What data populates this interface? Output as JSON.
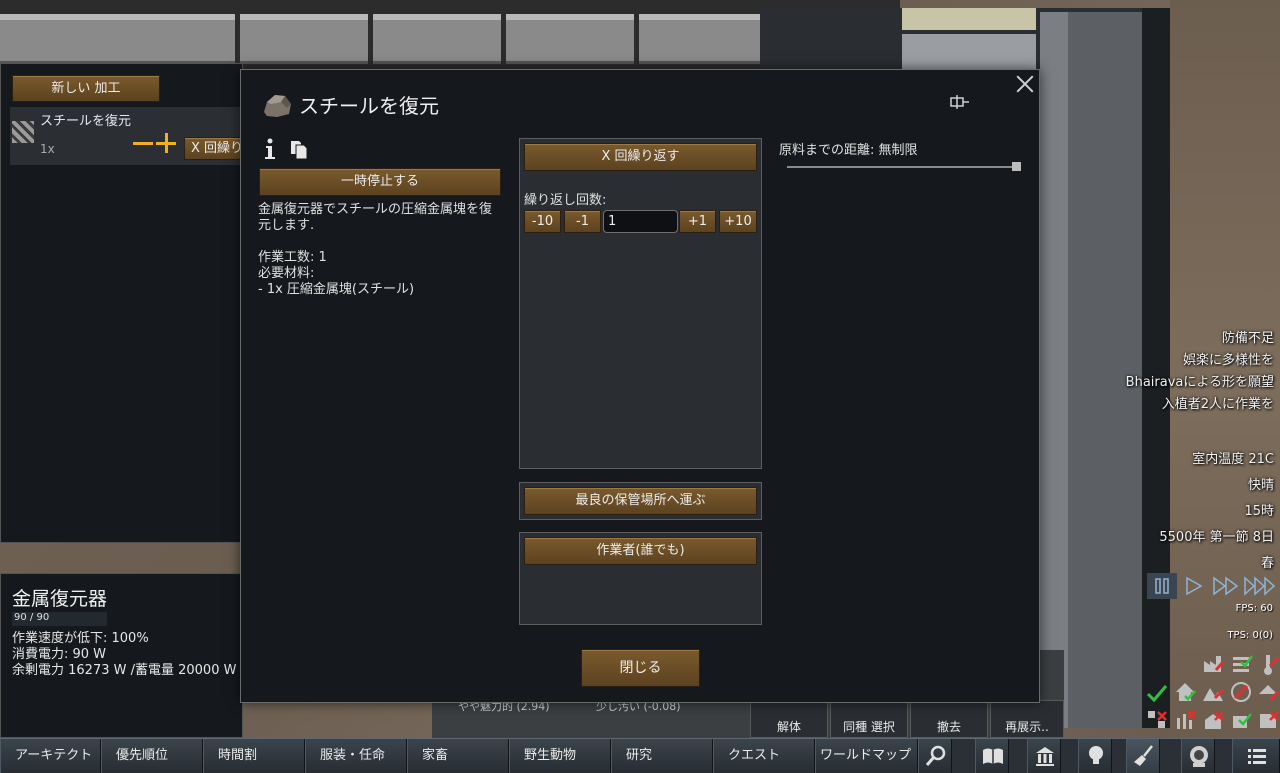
{
  "bills_panel": {
    "new_bill_label": "新しい 加工",
    "bill": {
      "name": "スチールを復元",
      "count": "1x",
      "repeat_label": "X 回繰り返す"
    }
  },
  "inspect": {
    "title": "金属復元器",
    "hp": "90 / 90",
    "lines": [
      "作業速度が低下: 100%",
      "消費電力: 90 W",
      "余剰電力 16273 W /蓄電量 20000 W"
    ]
  },
  "dialog": {
    "title": "スチールを復元",
    "pause_label": "一時停止する",
    "description": "金属復元器でスチールの圧縮金属塊を復元します.\n\n作業工数: 1\n必要材料:\n - 1x 圧縮金属塊(スチール)",
    "repeat_mode_label": "X 回繰り返す",
    "repeat_count_label": "繰り返し回数:",
    "step_minus10": "-10",
    "step_minus1": "-1",
    "count_value": "1",
    "step_plus1": "+1",
    "step_plus10": "+10",
    "store_label": "最良の保管場所へ運ぶ",
    "worker_label": "作業者(誰でも)",
    "ingredient_radius_label": "原料までの距離: 無制限",
    "ingredient_radius_fraction": 1.0,
    "close_label": "閉じる"
  },
  "alerts": [
    "防備不足",
    "娯楽に多様性を",
    "Bhairavaによる形を願望",
    "入植者2人に作業を"
  ],
  "clock": {
    "temperature": "室内温度 21C",
    "weather": "快晴",
    "hour": "15時",
    "date": "5500年 第一節 8日",
    "season": "春"
  },
  "perf": {
    "fps": "FPS: 60",
    "tps": "TPS: 0(0)"
  },
  "architect": {
    "deconstruct": "解体",
    "select_same": "同種 選択",
    "cancel": "撤去",
    "reinstall": "再展示.."
  },
  "background_text": {
    "left": "やや魅力的 (2.94)",
    "right": "少し汚い (-0.08)"
  },
  "tabs": [
    "アーキテクト",
    "優先順位",
    "時間割",
    "服装・任命",
    "家畜",
    "野生動物",
    "研究",
    "クエスト",
    "ワールドマップ"
  ],
  "icons": {
    "tab_icons": [
      "search-icon",
      "book-icon",
      "factions-icon",
      "lightbulb-icon",
      "broom-icon",
      "astronaut-icon",
      "menu-icon"
    ]
  },
  "colors": {
    "button_brown": "#6b4e26",
    "accent_yellow": "#f0b020",
    "panel_bg": "#15191d"
  }
}
